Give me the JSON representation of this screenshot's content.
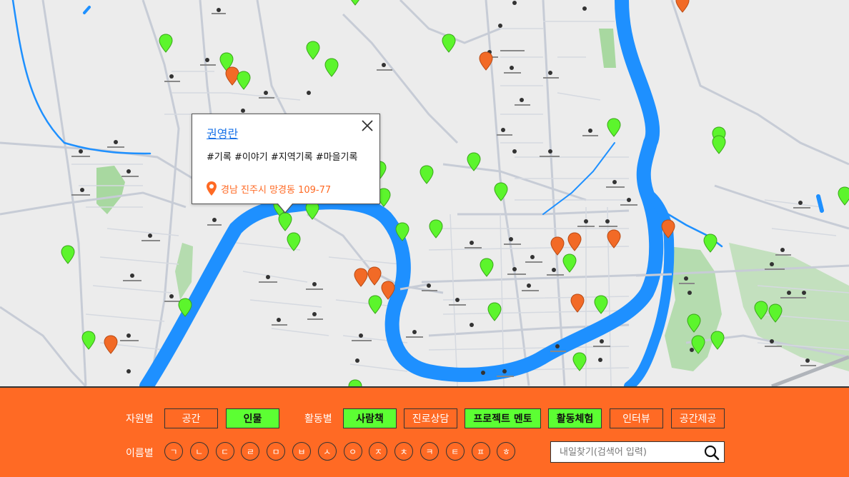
{
  "popup": {
    "name": "권영란",
    "tags": "#기록 #이야기 #지역기록 #마을기록",
    "address": "경남 진주시 망경동 109-77"
  },
  "filters": {
    "by_resource_label": "자원별",
    "by_resource": [
      {
        "label": "공간",
        "active": false
      },
      {
        "label": "인물",
        "active": true
      }
    ],
    "by_activity_label": "활동별",
    "by_activity": [
      {
        "label": "사람책",
        "active": true
      },
      {
        "label": "진로상담",
        "active": false
      },
      {
        "label": "프로젝트 멘토",
        "active": true
      },
      {
        "label": "활동체험",
        "active": true
      },
      {
        "label": "인터뷰",
        "active": false
      },
      {
        "label": "공간제공",
        "active": false
      }
    ],
    "by_name_label": "이름별",
    "initials": [
      "ㄱ",
      "ㄴ",
      "ㄷ",
      "ㄹ",
      "ㅁ",
      "ㅂ",
      "ㅅ",
      "ㅇ",
      "ㅈ",
      "ㅊ",
      "ㅋ",
      "ㅌ",
      "ㅍ",
      "ㅎ"
    ]
  },
  "search": {
    "placeholder": "내일찾기(검색어 입력)",
    "value": ""
  },
  "colors": {
    "accent": "#ff6a24",
    "active_chip": "#5cff33",
    "river": "#1e90ff",
    "pin_green": "#5cf52c",
    "pin_orange": "#f26a26"
  }
}
